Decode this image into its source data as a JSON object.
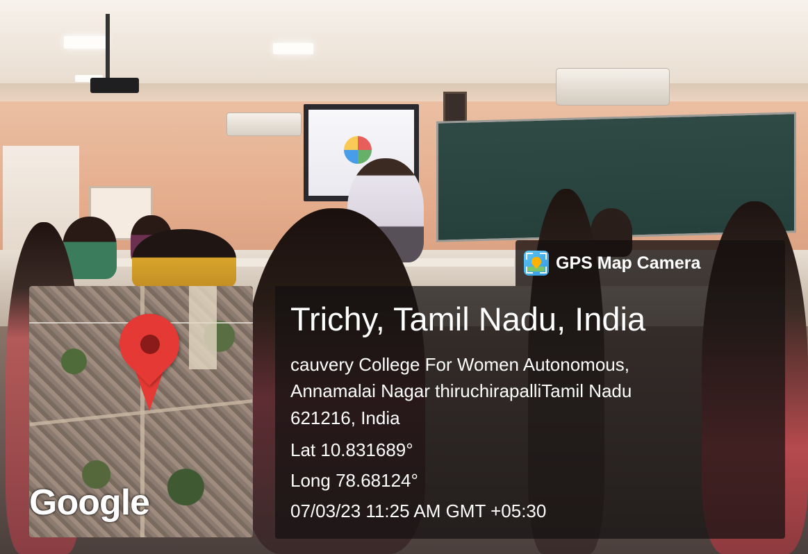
{
  "gps_badge": {
    "app_icon": "gps-map-camera-icon",
    "label": "GPS Map Camera"
  },
  "map": {
    "provider_logo": "Google",
    "marker_icon": "map-pin-icon",
    "marker_color": "#e53935"
  },
  "location": {
    "title": "Trichy, Tamil Nadu, India",
    "address_line1": "cauvery College For Women Autonomous,",
    "address_line2": "Annamalai Nagar thiruchirapalliTamil Nadu",
    "address_line3": "621216, India",
    "latitude": "Lat 10.831689°",
    "longitude": "Long 78.68124°",
    "timestamp": "07/03/23 11:25 AM GMT +05:30"
  }
}
